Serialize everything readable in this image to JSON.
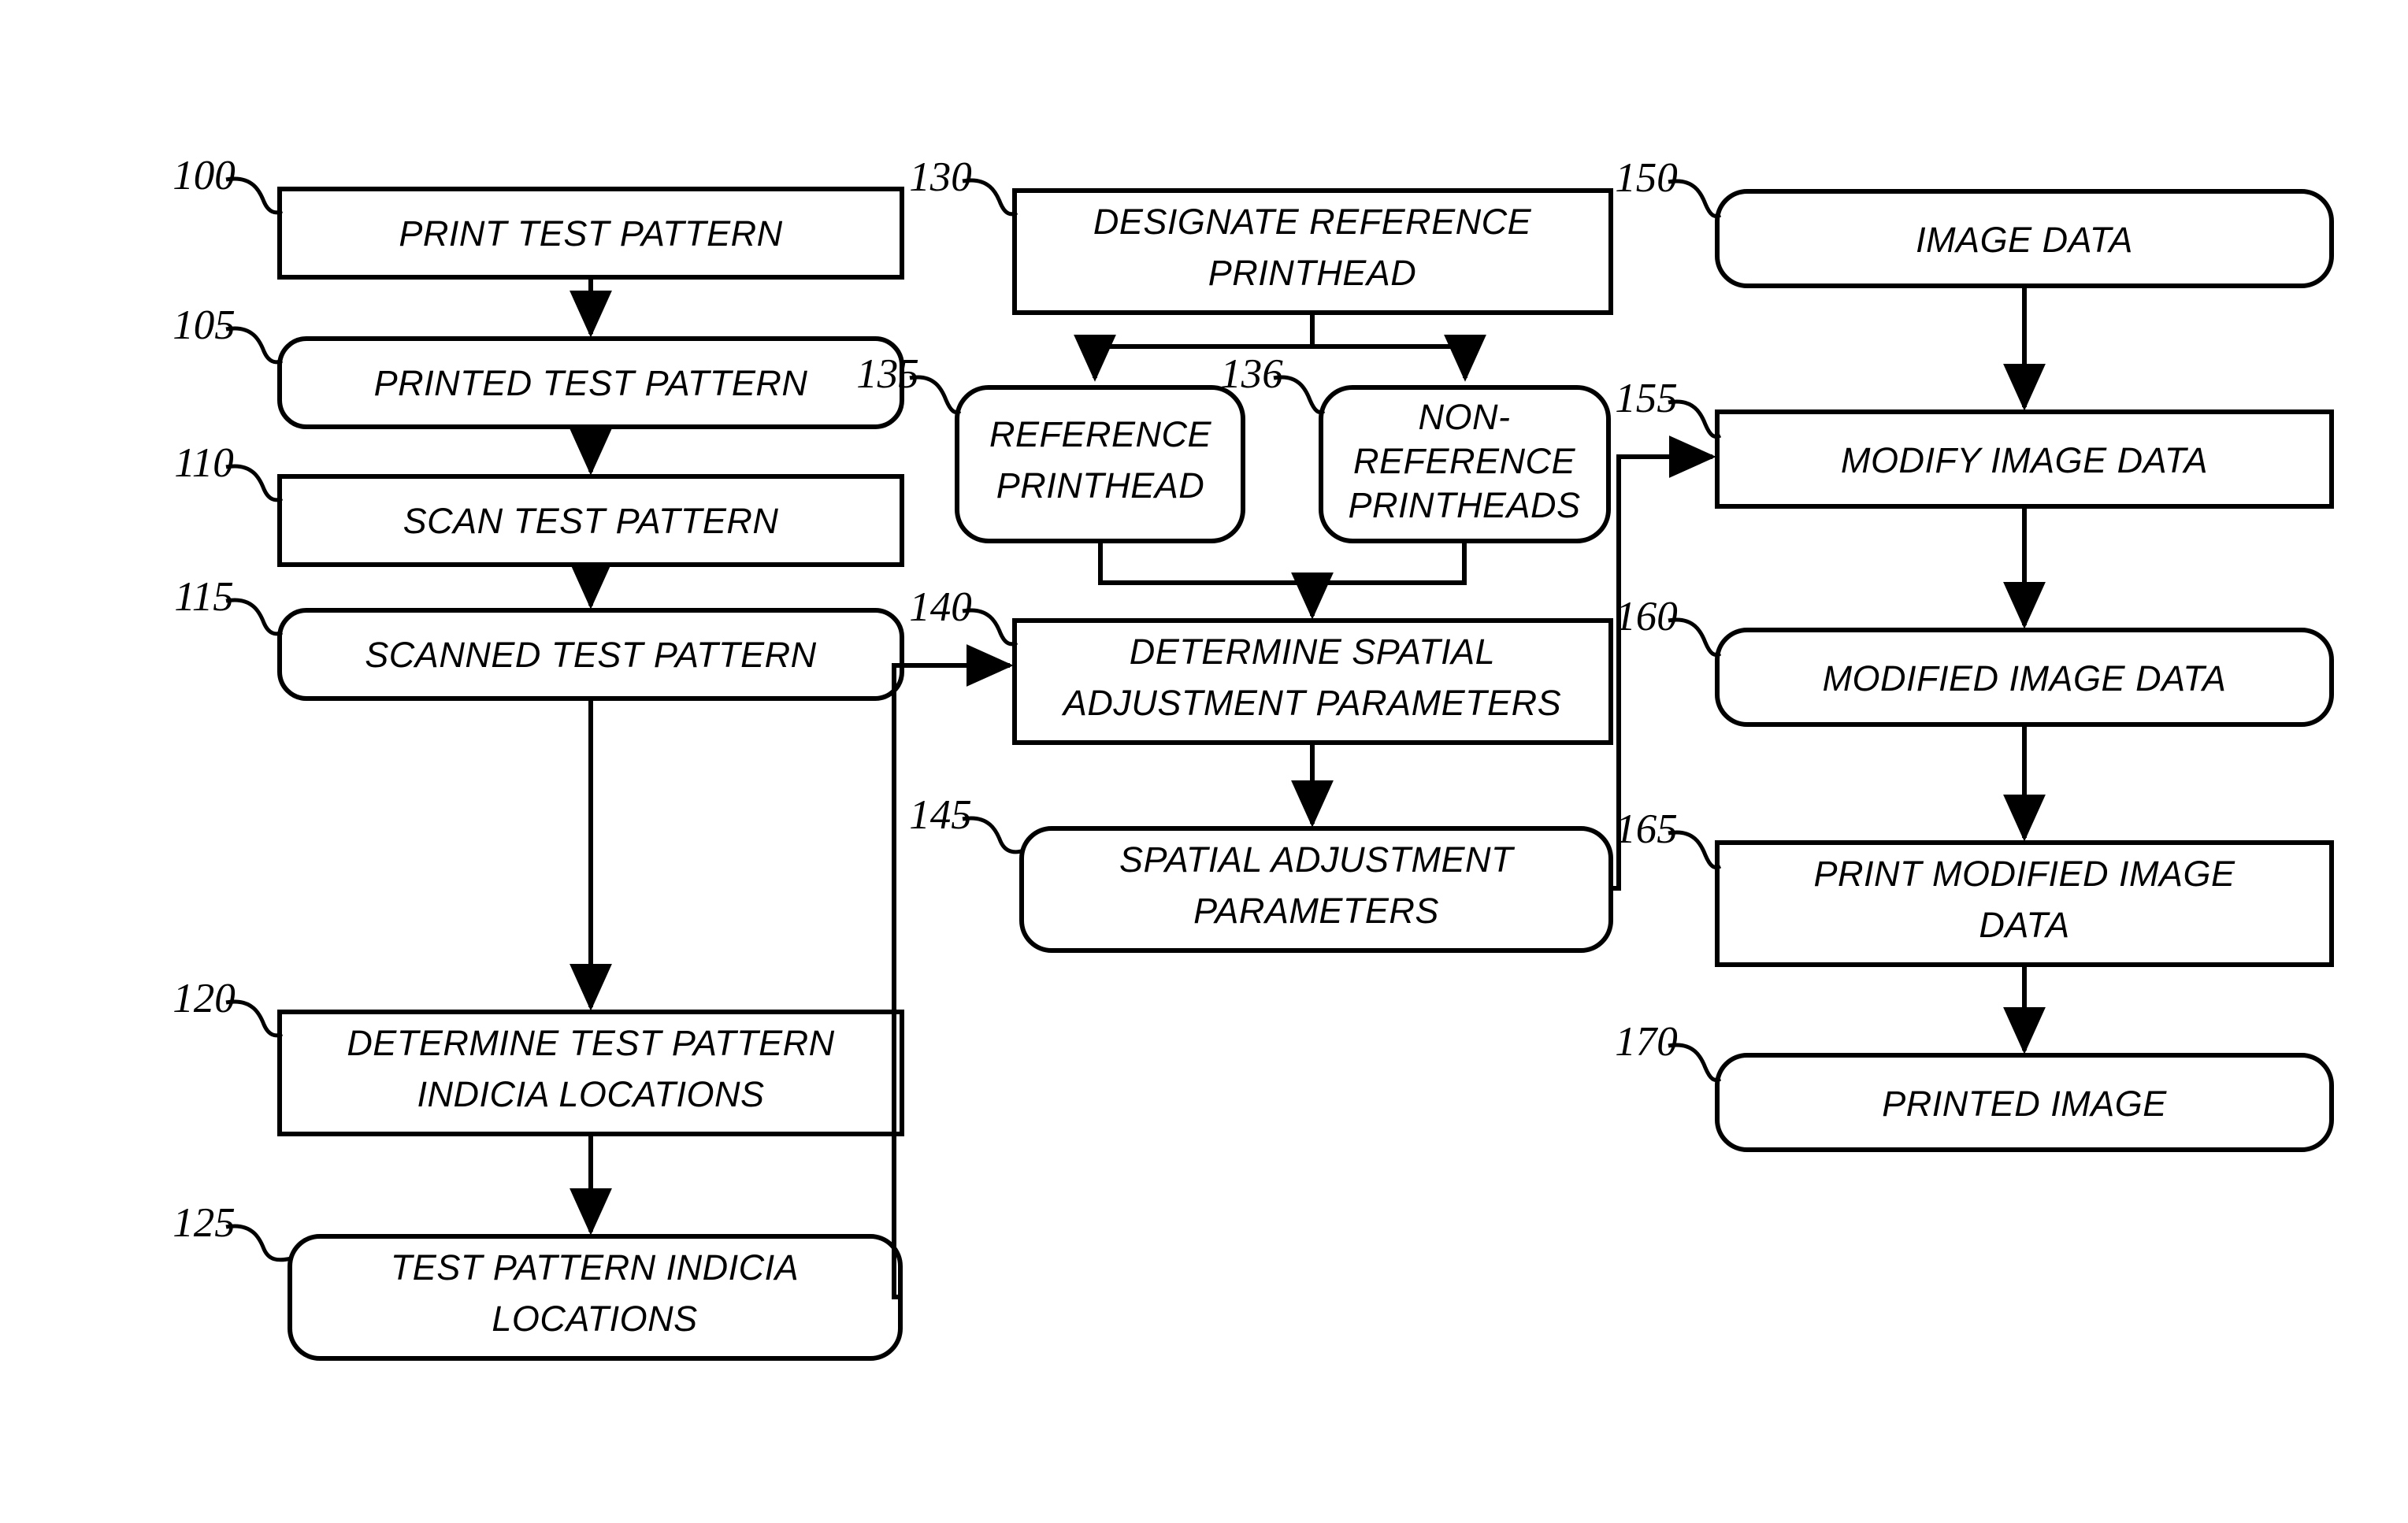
{
  "diagram": {
    "title": "Printhead spatial adjustment flowchart",
    "stroke_color": "#000000",
    "background_color": "#ffffff",
    "boxes": [
      {
        "ref": "100",
        "label": "PRINT TEST PATTERN",
        "shape": "rectangle",
        "column": "left",
        "lines": [
          "PRINT TEST PATTERN"
        ]
      },
      {
        "ref": "105",
        "label": "PRINTED TEST PATTERN",
        "shape": "rounded",
        "column": "left",
        "lines": [
          "PRINTED TEST PATTERN"
        ]
      },
      {
        "ref": "110",
        "label": "SCAN TEST PATTERN",
        "shape": "rectangle",
        "column": "left",
        "lines": [
          "SCAN TEST PATTERN"
        ]
      },
      {
        "ref": "115",
        "label": "SCANNED TEST PATTERN",
        "shape": "rounded",
        "column": "left",
        "lines": [
          "SCANNED TEST PATTERN"
        ]
      },
      {
        "ref": "120",
        "label": "DETERMINE TEST PATTERN INDICIA LOCATIONS",
        "shape": "rectangle",
        "column": "left",
        "lines": [
          "DETERMINE TEST PATTERN",
          "INDICIA LOCATIONS"
        ]
      },
      {
        "ref": "125",
        "label": "TEST PATTERN INDICIA LOCATIONS",
        "shape": "rounded",
        "column": "left",
        "lines": [
          "TEST PATTERN INDICIA",
          "LOCATIONS"
        ]
      },
      {
        "ref": "130",
        "label": "DESIGNATE REFERENCE PRINTHEAD",
        "shape": "rectangle",
        "column": "middle",
        "lines": [
          "DESIGNATE REFERENCE",
          "PRINTHEAD"
        ]
      },
      {
        "ref": "135",
        "label": "REFERENCE PRINTHEAD",
        "shape": "rounded",
        "column": "middle",
        "lines": [
          "REFERENCE",
          "PRINTHEAD"
        ]
      },
      {
        "ref": "136",
        "label": "NON-REFERENCE PRINTHEADS",
        "shape": "rounded",
        "column": "middle",
        "lines": [
          "NON-",
          "REFERENCE",
          "PRINTHEADS"
        ]
      },
      {
        "ref": "140",
        "label": "DETERMINE  SPATIAL ADJUSTMENT PARAMETERS",
        "shape": "rectangle",
        "column": "middle",
        "lines": [
          "DETERMINE  SPATIAL",
          "ADJUSTMENT PARAMETERS"
        ]
      },
      {
        "ref": "145",
        "label": "SPATIAL ADJUSTMENT PARAMETERS",
        "shape": "rounded",
        "column": "middle",
        "lines": [
          "SPATIAL ADJUSTMENT",
          "PARAMETERS"
        ]
      },
      {
        "ref": "150",
        "label": "IMAGE DATA",
        "shape": "rounded",
        "column": "right",
        "lines": [
          "IMAGE DATA"
        ]
      },
      {
        "ref": "155",
        "label": "MODIFY IMAGE DATA",
        "shape": "rectangle",
        "column": "right",
        "lines": [
          "MODIFY IMAGE DATA"
        ]
      },
      {
        "ref": "160",
        "label": "MODIFIED IMAGE DATA",
        "shape": "rounded",
        "column": "right",
        "lines": [
          "MODIFIED IMAGE DATA"
        ]
      },
      {
        "ref": "165",
        "label": "PRINT MODIFIED IMAGE DATA",
        "shape": "rectangle",
        "column": "right",
        "lines": [
          "PRINT MODIFIED IMAGE",
          "DATA"
        ]
      },
      {
        "ref": "170",
        "label": "PRINTED IMAGE",
        "shape": "rounded",
        "column": "right",
        "lines": [
          "PRINTED IMAGE"
        ]
      }
    ],
    "connections": [
      {
        "from": "100",
        "to": "105",
        "kind": "arrow-down"
      },
      {
        "from": "105",
        "to": "110",
        "kind": "arrow-down"
      },
      {
        "from": "110",
        "to": "115",
        "kind": "arrow-down"
      },
      {
        "from": "115",
        "to": "120",
        "kind": "arrow-down"
      },
      {
        "from": "120",
        "to": "125",
        "kind": "arrow-down"
      },
      {
        "from": "125",
        "to": "140",
        "kind": "routed-right-up-arrow"
      },
      {
        "from": "130",
        "to": "135",
        "kind": "fork-arrow-down"
      },
      {
        "from": "130",
        "to": "136",
        "kind": "fork-arrow-down"
      },
      {
        "from": "135",
        "to": "140",
        "kind": "merge-arrow-down"
      },
      {
        "from": "136",
        "to": "140",
        "kind": "merge-arrow-down"
      },
      {
        "from": "140",
        "to": "145",
        "kind": "arrow-down"
      },
      {
        "from": "145",
        "to": "155",
        "kind": "routed-right-up-arrow"
      },
      {
        "from": "150",
        "to": "155",
        "kind": "arrow-down"
      },
      {
        "from": "155",
        "to": "160",
        "kind": "arrow-down"
      },
      {
        "from": "160",
        "to": "165",
        "kind": "arrow-down"
      },
      {
        "from": "165",
        "to": "170",
        "kind": "arrow-down"
      }
    ]
  }
}
